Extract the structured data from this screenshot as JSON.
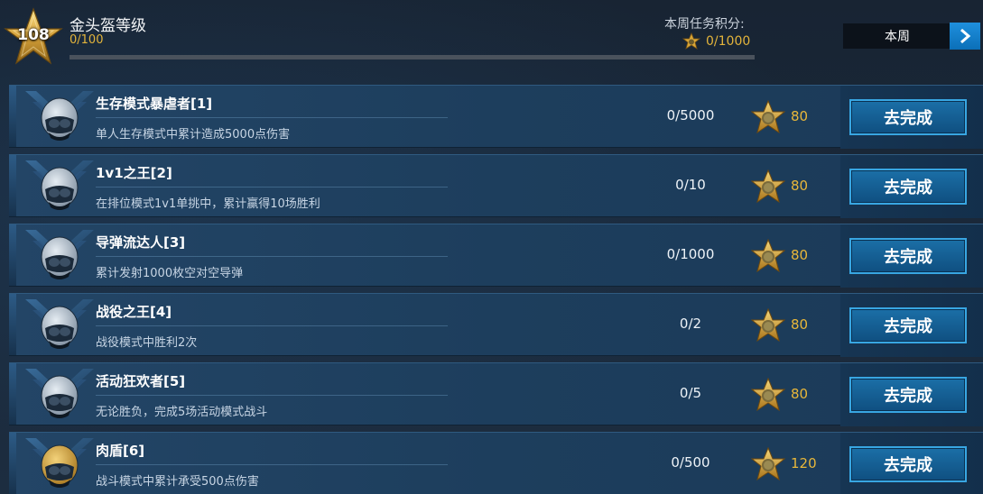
{
  "header": {
    "rank_number": "108",
    "title": "金头盔等级",
    "progress_text": "0/100",
    "progress_fraction": 0.0,
    "week_score_label": "本周任务积分:",
    "week_score_value": "0/1000",
    "week_select_label": "本周"
  },
  "tasks": [
    {
      "title": "生存模式暴虐者[1]",
      "desc": "单人生存模式中累计造成5000点伤害",
      "progress": "0/5000",
      "reward": "80",
      "button": "去完成",
      "icon": "silver-helmet-icon"
    },
    {
      "title": "1v1之王[2]",
      "desc": "在排位模式1v1单挑中，累计赢得10场胜利",
      "progress": "0/10",
      "reward": "80",
      "button": "去完成",
      "icon": "silver-helmet-icon"
    },
    {
      "title": "导弹流达人[3]",
      "desc": "累计发射1000枚空对空导弹",
      "progress": "0/1000",
      "reward": "80",
      "button": "去完成",
      "icon": "silver-helmet-icon"
    },
    {
      "title": "战役之王[4]",
      "desc": "战役模式中胜利2次",
      "progress": "0/2",
      "reward": "80",
      "button": "去完成",
      "icon": "silver-helmet-icon"
    },
    {
      "title": "活动狂欢者[5]",
      "desc": "无论胜负，完成5场活动模式战斗",
      "progress": "0/5",
      "reward": "80",
      "button": "去完成",
      "icon": "silver-helmet-icon"
    },
    {
      "title": "肉盾[6]",
      "desc": "战斗模式中累计承受500点伤害",
      "progress": "0/500",
      "reward": "120",
      "button": "去完成",
      "icon": "gold-helmet-icon"
    }
  ],
  "colors": {
    "accent_gold": "#e3b43b",
    "button_blue": "#1b6fa7",
    "button_border": "#38a6e2"
  }
}
